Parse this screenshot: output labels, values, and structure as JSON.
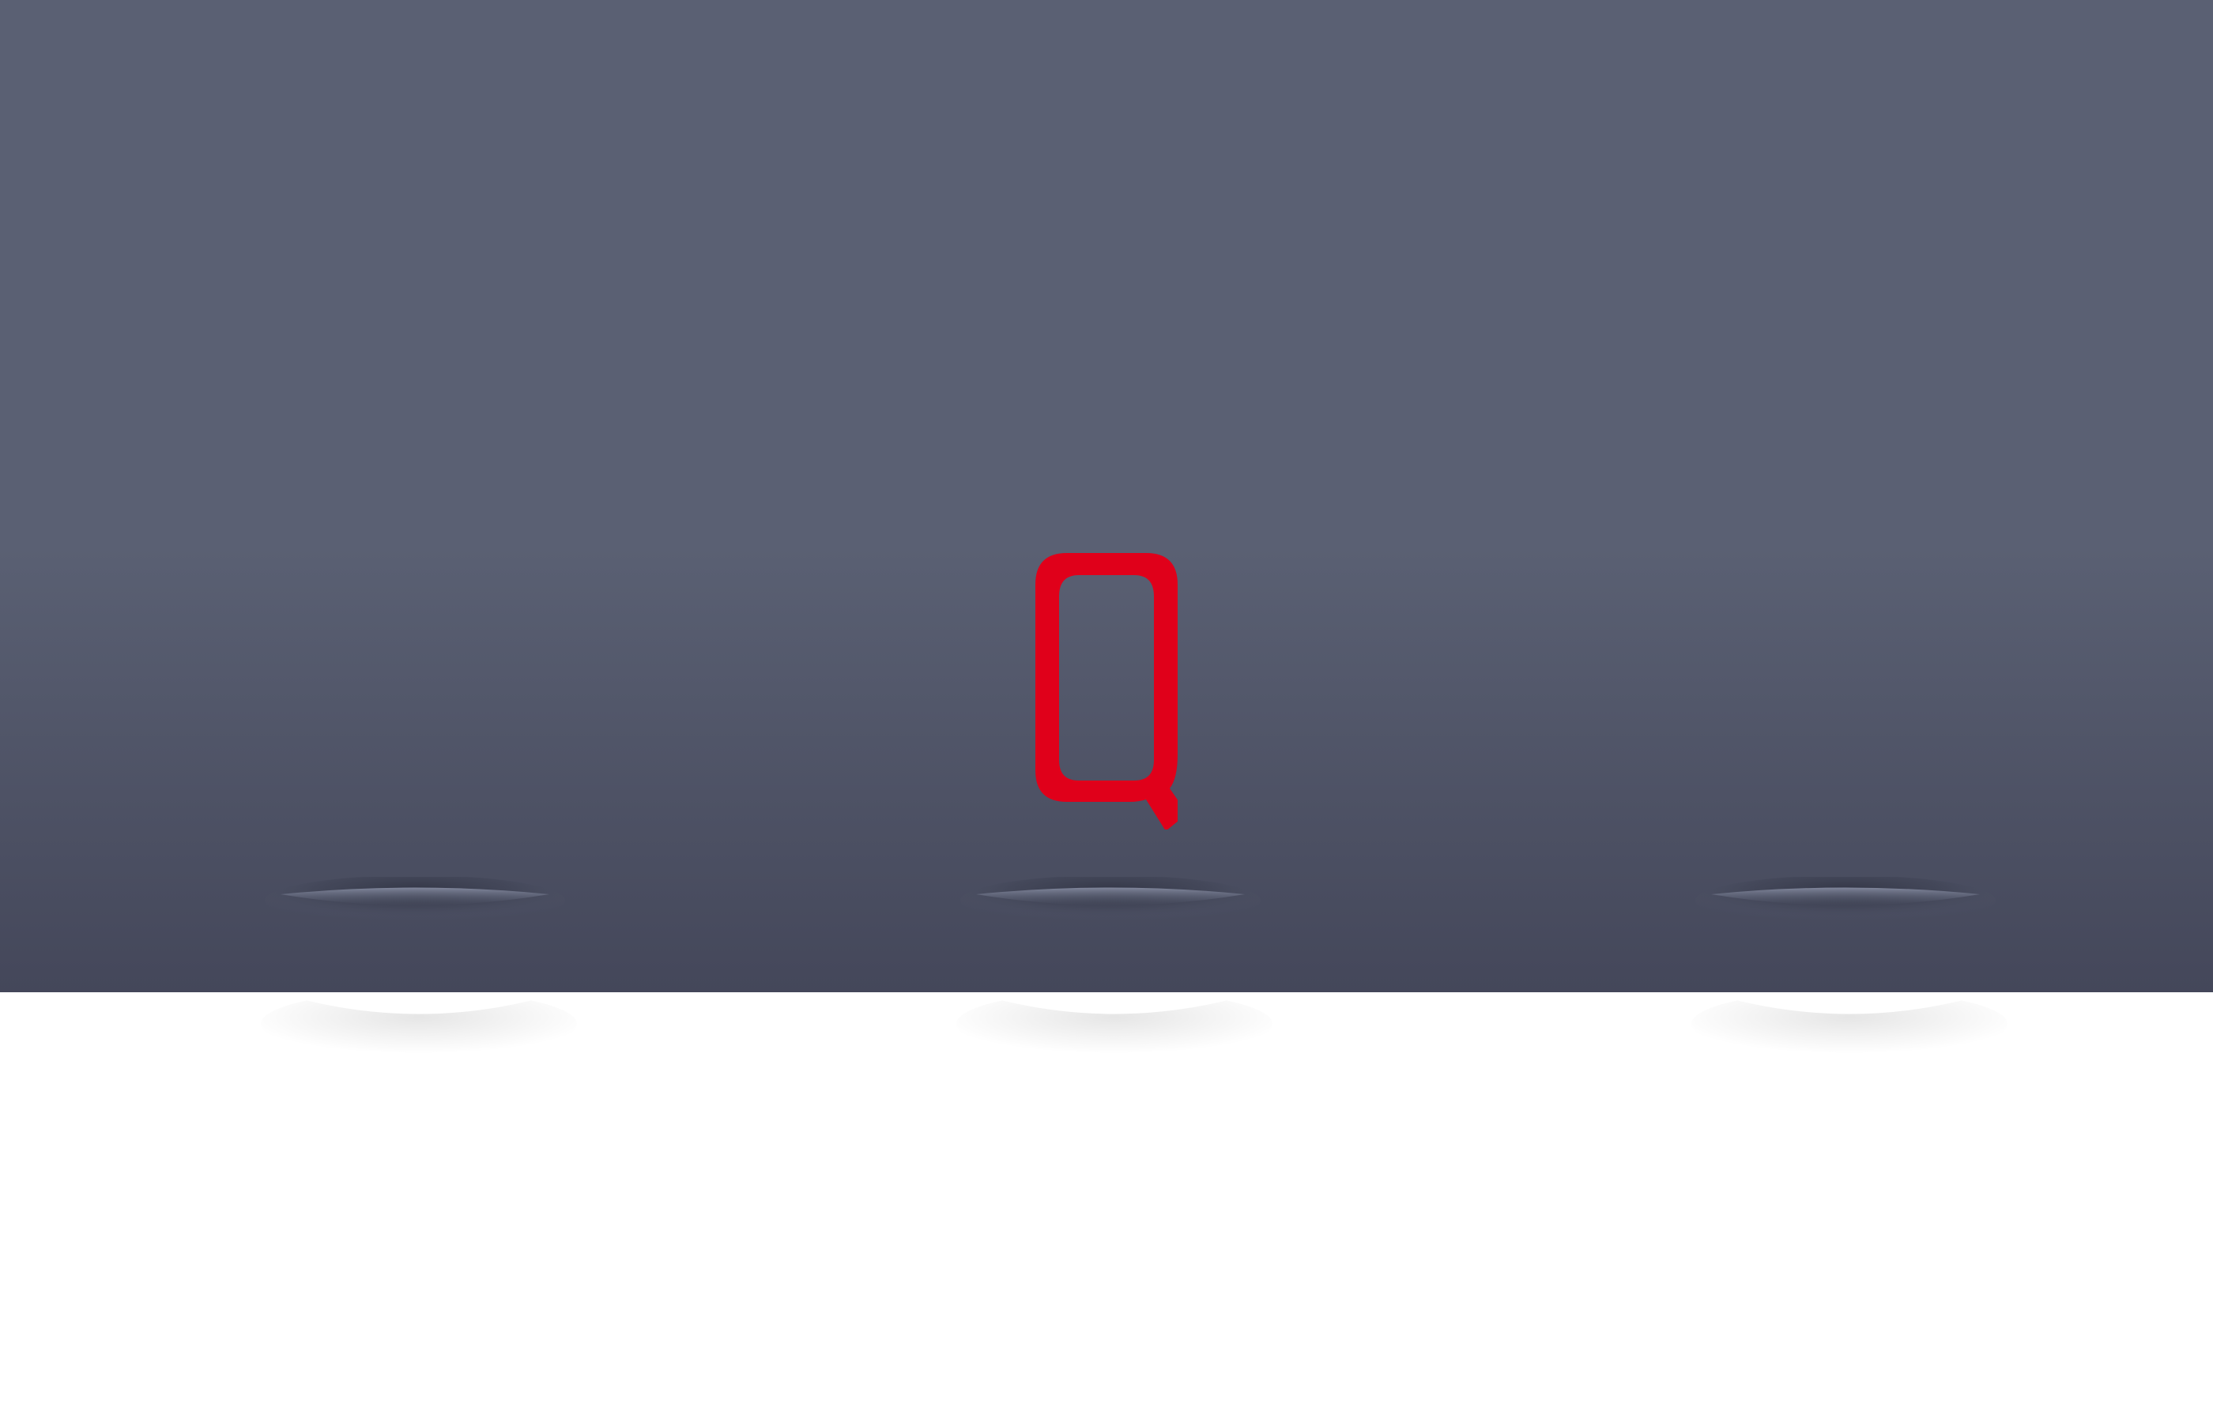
{
  "logo": {
    "name": "q-letter-logo",
    "glyph": "Q",
    "color": "#e0001a"
  },
  "colors": {
    "panel_top": "#5a6073",
    "panel_bottom": "#44475a",
    "background": "#ffffff"
  },
  "indicators": {
    "count": 3,
    "active_index": 1
  }
}
